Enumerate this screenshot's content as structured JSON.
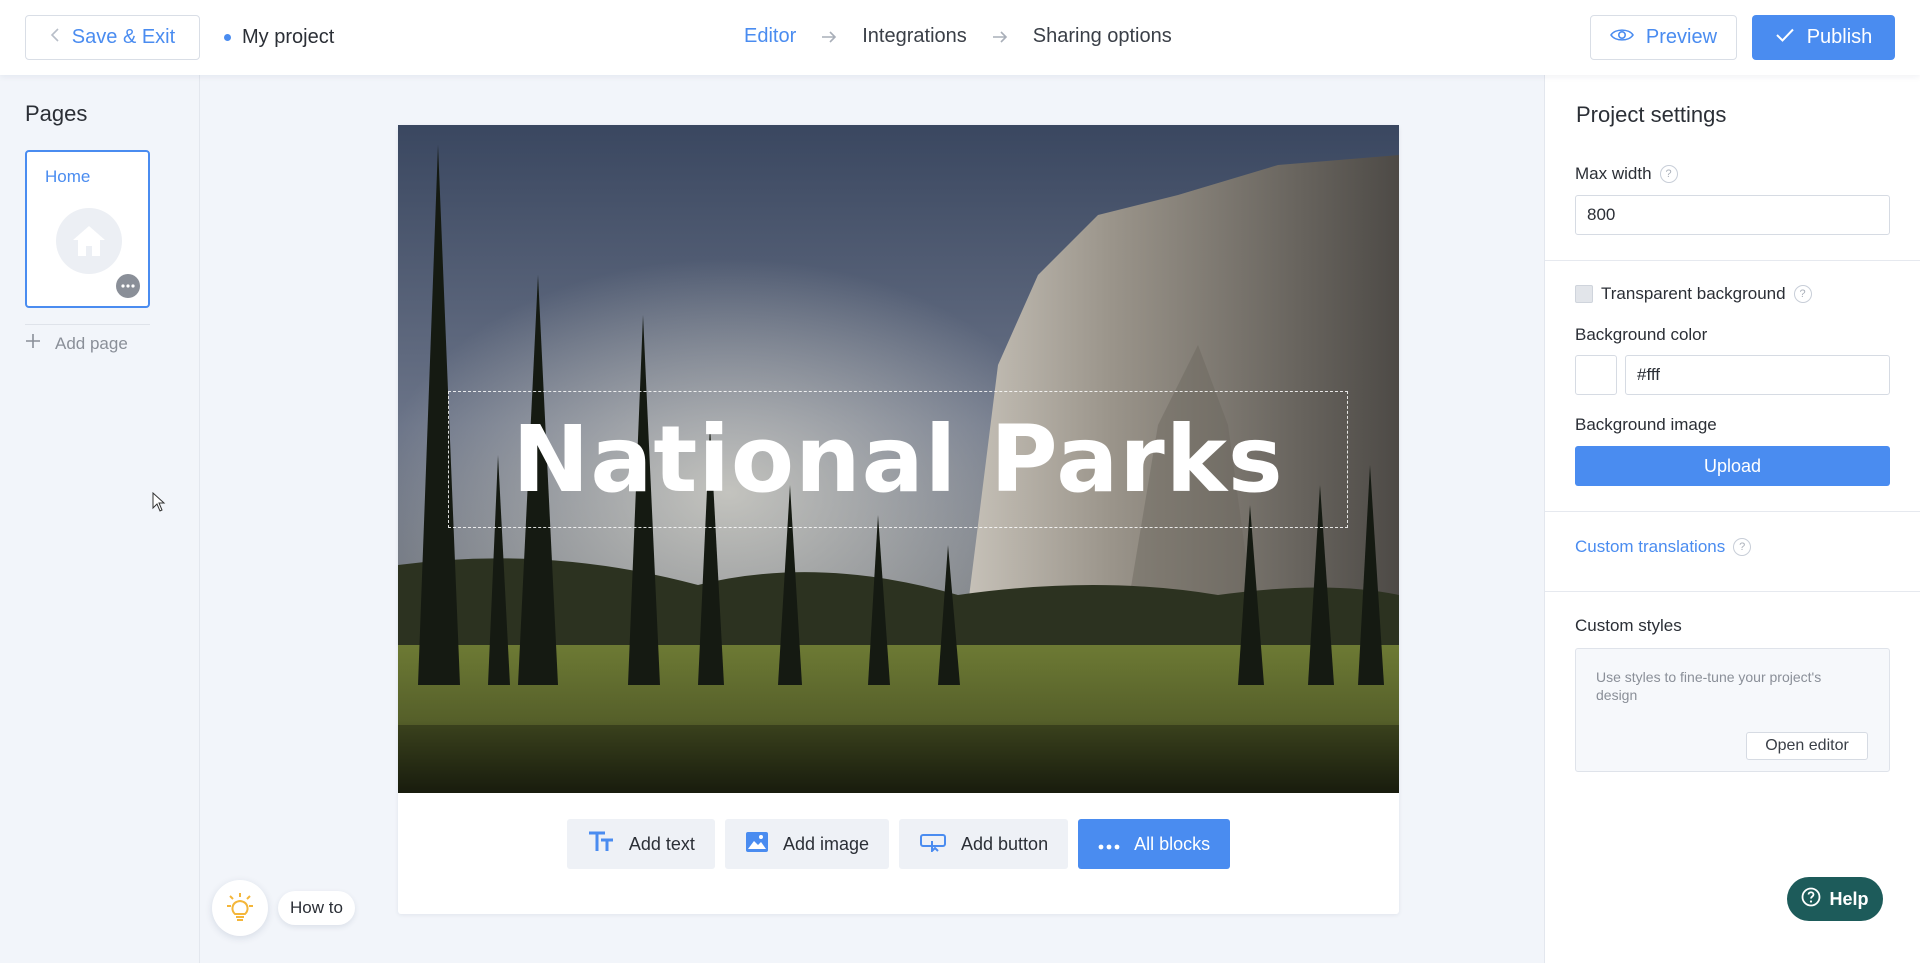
{
  "header": {
    "save_exit_label": "Save & Exit",
    "project_name": "My project",
    "steps": [
      {
        "label": "Editor",
        "active": true
      },
      {
        "label": "Integrations",
        "active": false
      },
      {
        "label": "Sharing options",
        "active": false
      }
    ],
    "preview_label": "Preview",
    "publish_label": "Publish"
  },
  "sidebar": {
    "title": "Pages",
    "pages": [
      {
        "label": "Home",
        "icon": "home-icon"
      }
    ],
    "add_page_label": "Add page"
  },
  "canvas": {
    "hero_title": "National Parks",
    "blocks": [
      {
        "label": "Add text",
        "icon": "text-icon"
      },
      {
        "label": "Add image",
        "icon": "image-icon"
      },
      {
        "label": "Add button",
        "icon": "button-icon"
      },
      {
        "label": "All blocks",
        "icon": "more-dots-icon"
      }
    ]
  },
  "settings": {
    "title": "Project settings",
    "max_width_label": "Max width",
    "max_width_value": "800",
    "transparent_bg_label": "Transparent background",
    "transparent_bg_checked": false,
    "bg_color_label": "Background color",
    "bg_color_value": "#fff",
    "bg_image_label": "Background image",
    "upload_label": "Upload",
    "custom_translations_label": "Custom translations",
    "custom_styles_label": "Custom styles",
    "custom_styles_hint": "Use styles to fine-tune your project's design",
    "open_editor_label": "Open editor"
  },
  "floating": {
    "howto_label": "How to",
    "help_label": "Help"
  },
  "colors": {
    "accent": "#4a8cf0",
    "help_bg": "#1d5b5a"
  }
}
